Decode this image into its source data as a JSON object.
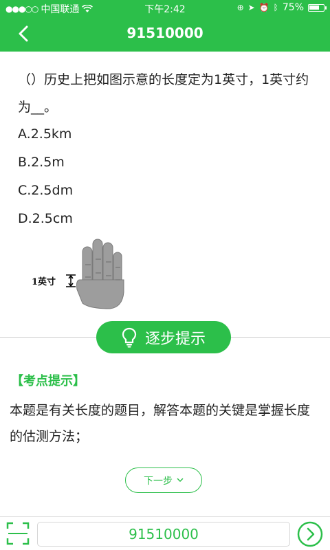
{
  "status_bar": {
    "carrier": "中国联通",
    "time": "下午2:42",
    "battery": "75%",
    "battery_level": 0.75
  },
  "nav": {
    "title": "91510000"
  },
  "question": {
    "text": "（）历史上把如图示意的长度定为1英寸，1英寸约为__。",
    "options": [
      "A.2.5km",
      "B.2.5m",
      "C.2.5dm",
      "D.2.5cm"
    ],
    "figure_label": "1英寸"
  },
  "hint": {
    "button_label": "逐步提示"
  },
  "answer": {
    "section_label": "【考点提示】",
    "text": "本题是有关长度的题目，解答本题的关键是掌握长度的估测方法；"
  },
  "next": {
    "label": "下一步"
  },
  "bottom": {
    "code_value": "91510000"
  },
  "colors": {
    "brand_green": "#2cbf4a"
  }
}
